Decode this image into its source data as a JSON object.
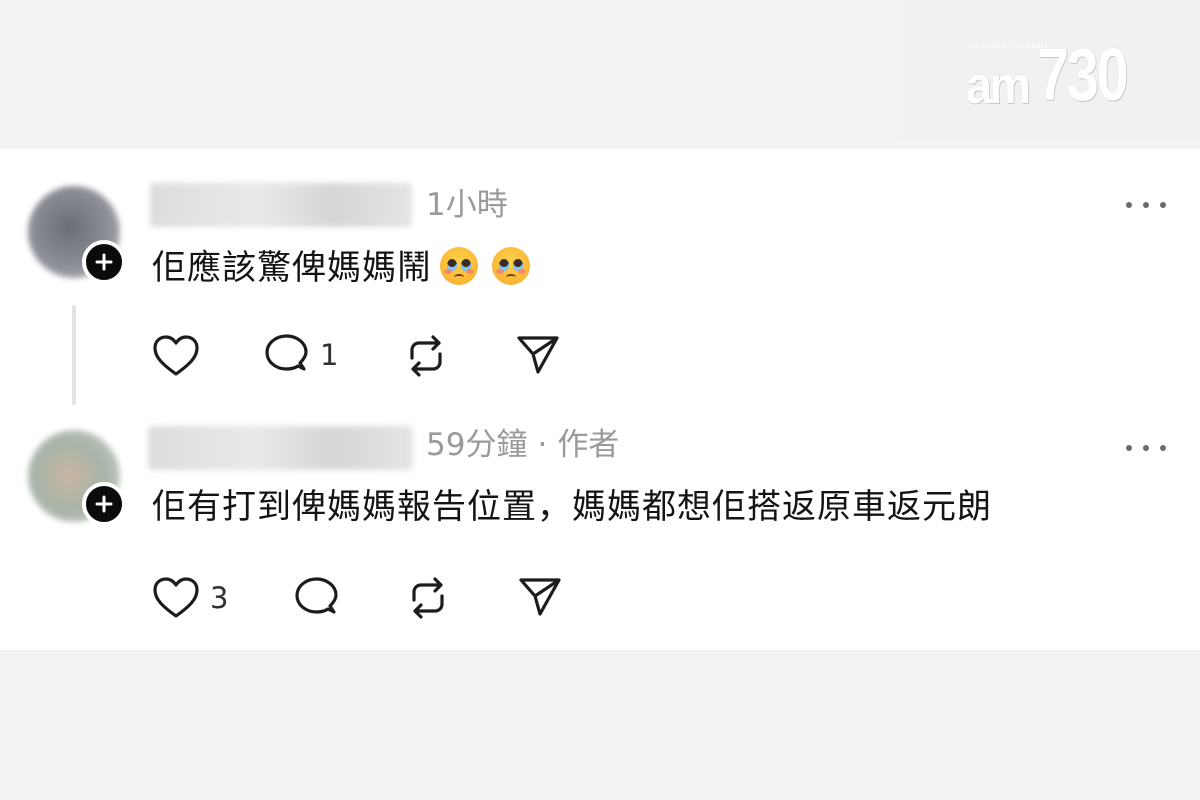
{
  "watermark": {
    "tagline": "my choice . my paper",
    "brand_prefix": "am",
    "brand_number": "730"
  },
  "posts": [
    {
      "timestamp": "1小時",
      "author_tag": "",
      "text": "佢應該驚俾媽媽鬧",
      "emojis": [
        "pleading-face",
        "pleading-face"
      ],
      "actions": {
        "like_count": "",
        "reply_count": "1",
        "repost_count": "",
        "share_count": ""
      }
    },
    {
      "timestamp": "59分鐘",
      "author_tag": "作者",
      "separator": "·",
      "text": "佢有打到俾媽媽報告位置，媽媽都想佢搭返原車返元朗",
      "emojis": [],
      "actions": {
        "like_count": "3",
        "reply_count": "",
        "repost_count": "",
        "share_count": ""
      }
    }
  ],
  "icons": {
    "follow": "plus-icon",
    "more": "more-horizontal-icon",
    "like": "heart-icon",
    "reply": "comment-icon",
    "repost": "repost-icon",
    "share": "send-icon"
  },
  "colors": {
    "page_background": "#f3f3f3",
    "card_background": "#ffffff",
    "text": "#141414",
    "meta_text": "#9a9a9a",
    "icon": "#1c1c1c"
  }
}
